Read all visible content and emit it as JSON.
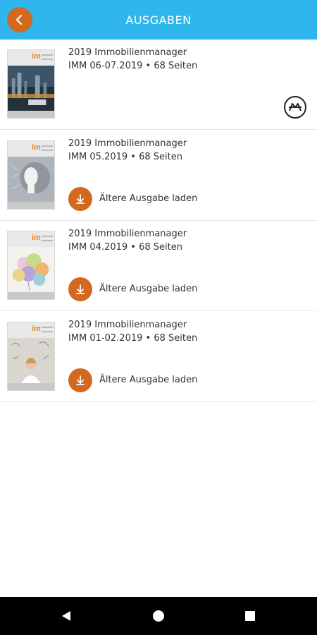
{
  "header": {
    "title": "AUSGABEN",
    "back_icon": "chevron-left-icon",
    "color": "#2fb6ec",
    "accent": "#d2691f"
  },
  "issues": [
    {
      "title": "2019 Immobilienmanager",
      "subtitle": "IMM 06-07.2019 • 68 Seiten",
      "action": "open",
      "action_icon": "reader-icon"
    },
    {
      "title": "2019 Immobilienmanager",
      "subtitle": "IMM 05.2019 • 68 Seiten",
      "action": "download",
      "action_label": "Ältere Ausgabe laden",
      "action_icon": "download-icon"
    },
    {
      "title": "2019 Immobilienmanager",
      "subtitle": "IMM 04.2019 • 68 Seiten",
      "action": "download",
      "action_label": "Ältere Ausgabe laden",
      "action_icon": "download-icon"
    },
    {
      "title": "2019 Immobilienmanager",
      "subtitle": "IMM 01-02.2019 • 68 Seiten",
      "action": "download",
      "action_label": "Ältere Ausgabe laden",
      "action_icon": "download-icon"
    }
  ],
  "cover_logo": "im",
  "navbar": {
    "back_icon": "triangle-back-icon",
    "home_icon": "circle-home-icon",
    "recents_icon": "square-recents-icon"
  }
}
